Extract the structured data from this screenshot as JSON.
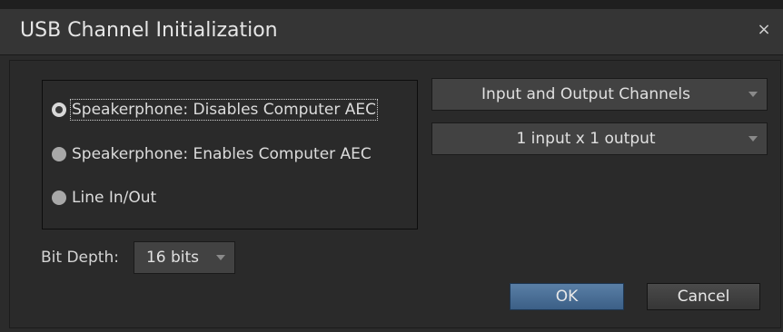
{
  "dialog": {
    "title": "USB Channel Initialization",
    "close_glyph": "×"
  },
  "mode_options": [
    {
      "label": "Speakerphone: Disables Computer AEC",
      "selected": true
    },
    {
      "label": "Speakerphone: Enables Computer AEC",
      "selected": false
    },
    {
      "label": "Line In/Out",
      "selected": false
    }
  ],
  "channel_type_select": {
    "value": "Input and Output Channels"
  },
  "channel_count_select": {
    "value": "1 input x 1 output"
  },
  "bit_depth": {
    "label": "Bit Depth:",
    "value": "16 bits"
  },
  "buttons": {
    "ok_label": "OK",
    "cancel_label": "Cancel"
  },
  "icons": {
    "close": "close-icon",
    "dropdown": "chevron-down-icon"
  },
  "colors": {
    "background": "#2b2b2b",
    "title_bar": "#353535",
    "primary_button": "#4a6f96",
    "text": "#dcdcdc"
  }
}
